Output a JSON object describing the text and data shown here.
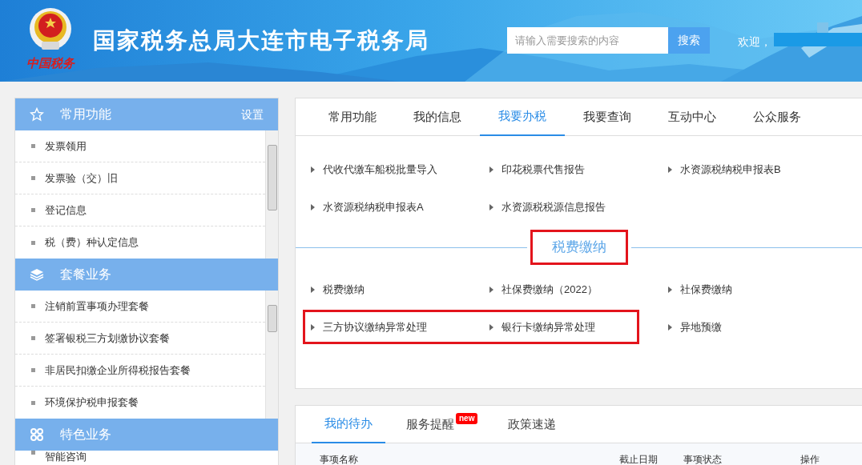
{
  "header": {
    "logo_text": "中国税务",
    "title": "国家税务总局大连市电子税务局",
    "search": {
      "placeholder": "请输入需要搜索的内容",
      "button": "搜索"
    },
    "welcome": "欢迎，"
  },
  "sidebar": [
    {
      "kind": "star",
      "title": "常用功能",
      "action": "设置",
      "items": [
        "发票领用",
        "发票验（交）旧",
        "登记信息",
        "税（费）种认定信息"
      ]
    },
    {
      "kind": "layers",
      "title": "套餐业务",
      "items": [
        "注销前置事项办理套餐",
        "签署银税三方划缴协议套餐",
        "非居民扣缴企业所得税报告套餐",
        "环境保护税申报套餐"
      ]
    },
    {
      "kind": "grid",
      "title": "特色业务",
      "items": [
        "智能咨询"
      ]
    }
  ],
  "main_tabs": [
    {
      "label": "常用功能",
      "selected": false
    },
    {
      "label": "我的信息",
      "selected": false
    },
    {
      "label": "我要办税",
      "selected": true
    },
    {
      "label": "我要查询",
      "selected": false
    },
    {
      "label": "互动中心",
      "selected": false
    },
    {
      "label": "公众服务",
      "selected": false
    }
  ],
  "groups": [
    {
      "items": [
        {
          "label": "代收代缴车船税批量导入",
          "highlighted": false
        },
        {
          "label": "印花税票代售报告",
          "highlighted": false
        },
        {
          "label": "水资源税纳税申报表B",
          "highlighted": false
        },
        {
          "label": "水资源税纳税申报表A",
          "highlighted": false
        },
        {
          "label": "水资源税税源信息报告",
          "highlighted": false
        }
      ]
    },
    {
      "title": "税费缴纳",
      "highlighted": true,
      "items": [
        {
          "label": "税费缴纳",
          "highlighted": false
        },
        {
          "label": "社保费缴纳（2022）",
          "highlighted": false
        },
        {
          "label": "社保费缴纳",
          "highlighted": false
        },
        {
          "label": "三方协议缴纳异常处理",
          "highlighted": true
        },
        {
          "label": "银行卡缴纳异常处理",
          "highlighted": true
        },
        {
          "label": "异地预缴",
          "highlighted": false
        }
      ]
    }
  ],
  "todo_tabs": [
    {
      "label": "我的待办",
      "selected": true
    },
    {
      "label": "服务提醒",
      "selected": false,
      "badge": "new"
    },
    {
      "label": "政策速递",
      "selected": false
    }
  ],
  "table": {
    "columns": [
      "事项名称",
      "截止日期",
      "事项状态",
      "操作"
    ]
  }
}
